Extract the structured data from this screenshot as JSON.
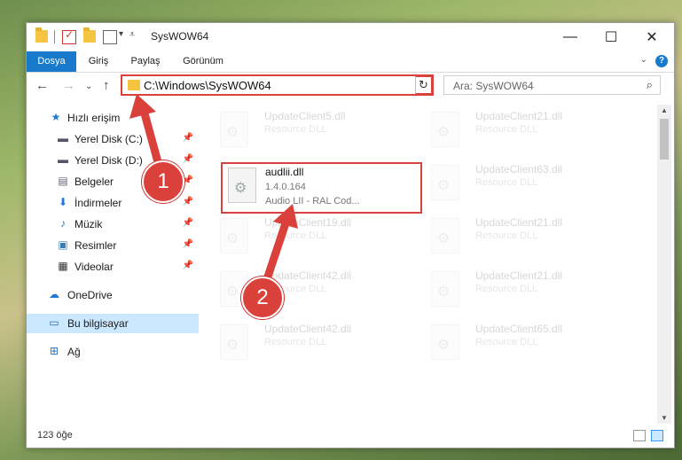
{
  "window": {
    "title": "SysWOW64"
  },
  "ribbon": {
    "tabs": [
      {
        "label": "Dosya"
      },
      {
        "label": "Giriş"
      },
      {
        "label": "Paylaş"
      },
      {
        "label": "Görünüm"
      }
    ],
    "help": "?"
  },
  "address": {
    "path": "C:\\Windows\\SysWOW64"
  },
  "search": {
    "placeholder": "Ara: SysWOW64"
  },
  "sidebar": {
    "items": [
      {
        "label": "Hızlı erişim",
        "icon": "star-icon"
      },
      {
        "label": "Yerel Disk (C:)",
        "icon": "drive-icon",
        "pinned": true
      },
      {
        "label": "Yerel Disk (D:)",
        "icon": "drive-icon",
        "pinned": true
      },
      {
        "label": "Belgeler",
        "icon": "document-icon",
        "pinned": true
      },
      {
        "label": "İndirmeler",
        "icon": "download-icon",
        "pinned": true
      },
      {
        "label": "Müzik",
        "icon": "music-icon",
        "pinned": true
      },
      {
        "label": "Resimler",
        "icon": "pictures-icon",
        "pinned": true
      },
      {
        "label": "Videolar",
        "icon": "video-icon",
        "pinned": true
      },
      {
        "label": "OneDrive",
        "icon": "cloud-icon"
      },
      {
        "label": "Bu bilgisayar",
        "icon": "computer-icon",
        "selected": true
      },
      {
        "label": "Ağ",
        "icon": "network-icon"
      }
    ]
  },
  "files": {
    "highlighted": {
      "name": "audlii.dll",
      "version": "1.4.0.164",
      "description": "Audio LII - RAL Cod..."
    },
    "background": [
      {
        "name": "UpdateClient5.dll",
        "type": "Resource DLL"
      },
      {
        "name": "UpdateClient21.dll",
        "type": "Resource DLL"
      },
      {
        "name": "UpdateClient63.dll",
        "type": "Resource DLL"
      },
      {
        "name": "UpdateClient19.dll",
        "type": "Resource DLL"
      },
      {
        "name": "UpdateClient21.dll",
        "type": "Resource DLL"
      },
      {
        "name": "UpdateClient42.dll",
        "type": "Resource DLL"
      },
      {
        "name": "UpdateClient21.dll",
        "type": "Resource DLL"
      },
      {
        "name": "UpdateClient42.dll",
        "type": "Resource DLL"
      },
      {
        "name": "UpdateClient65.dll",
        "type": "Resource DLL"
      }
    ]
  },
  "status": {
    "count": "123 öğe"
  },
  "annotations": {
    "step1": "1",
    "step2": "2",
    "color": "#d9413a"
  }
}
